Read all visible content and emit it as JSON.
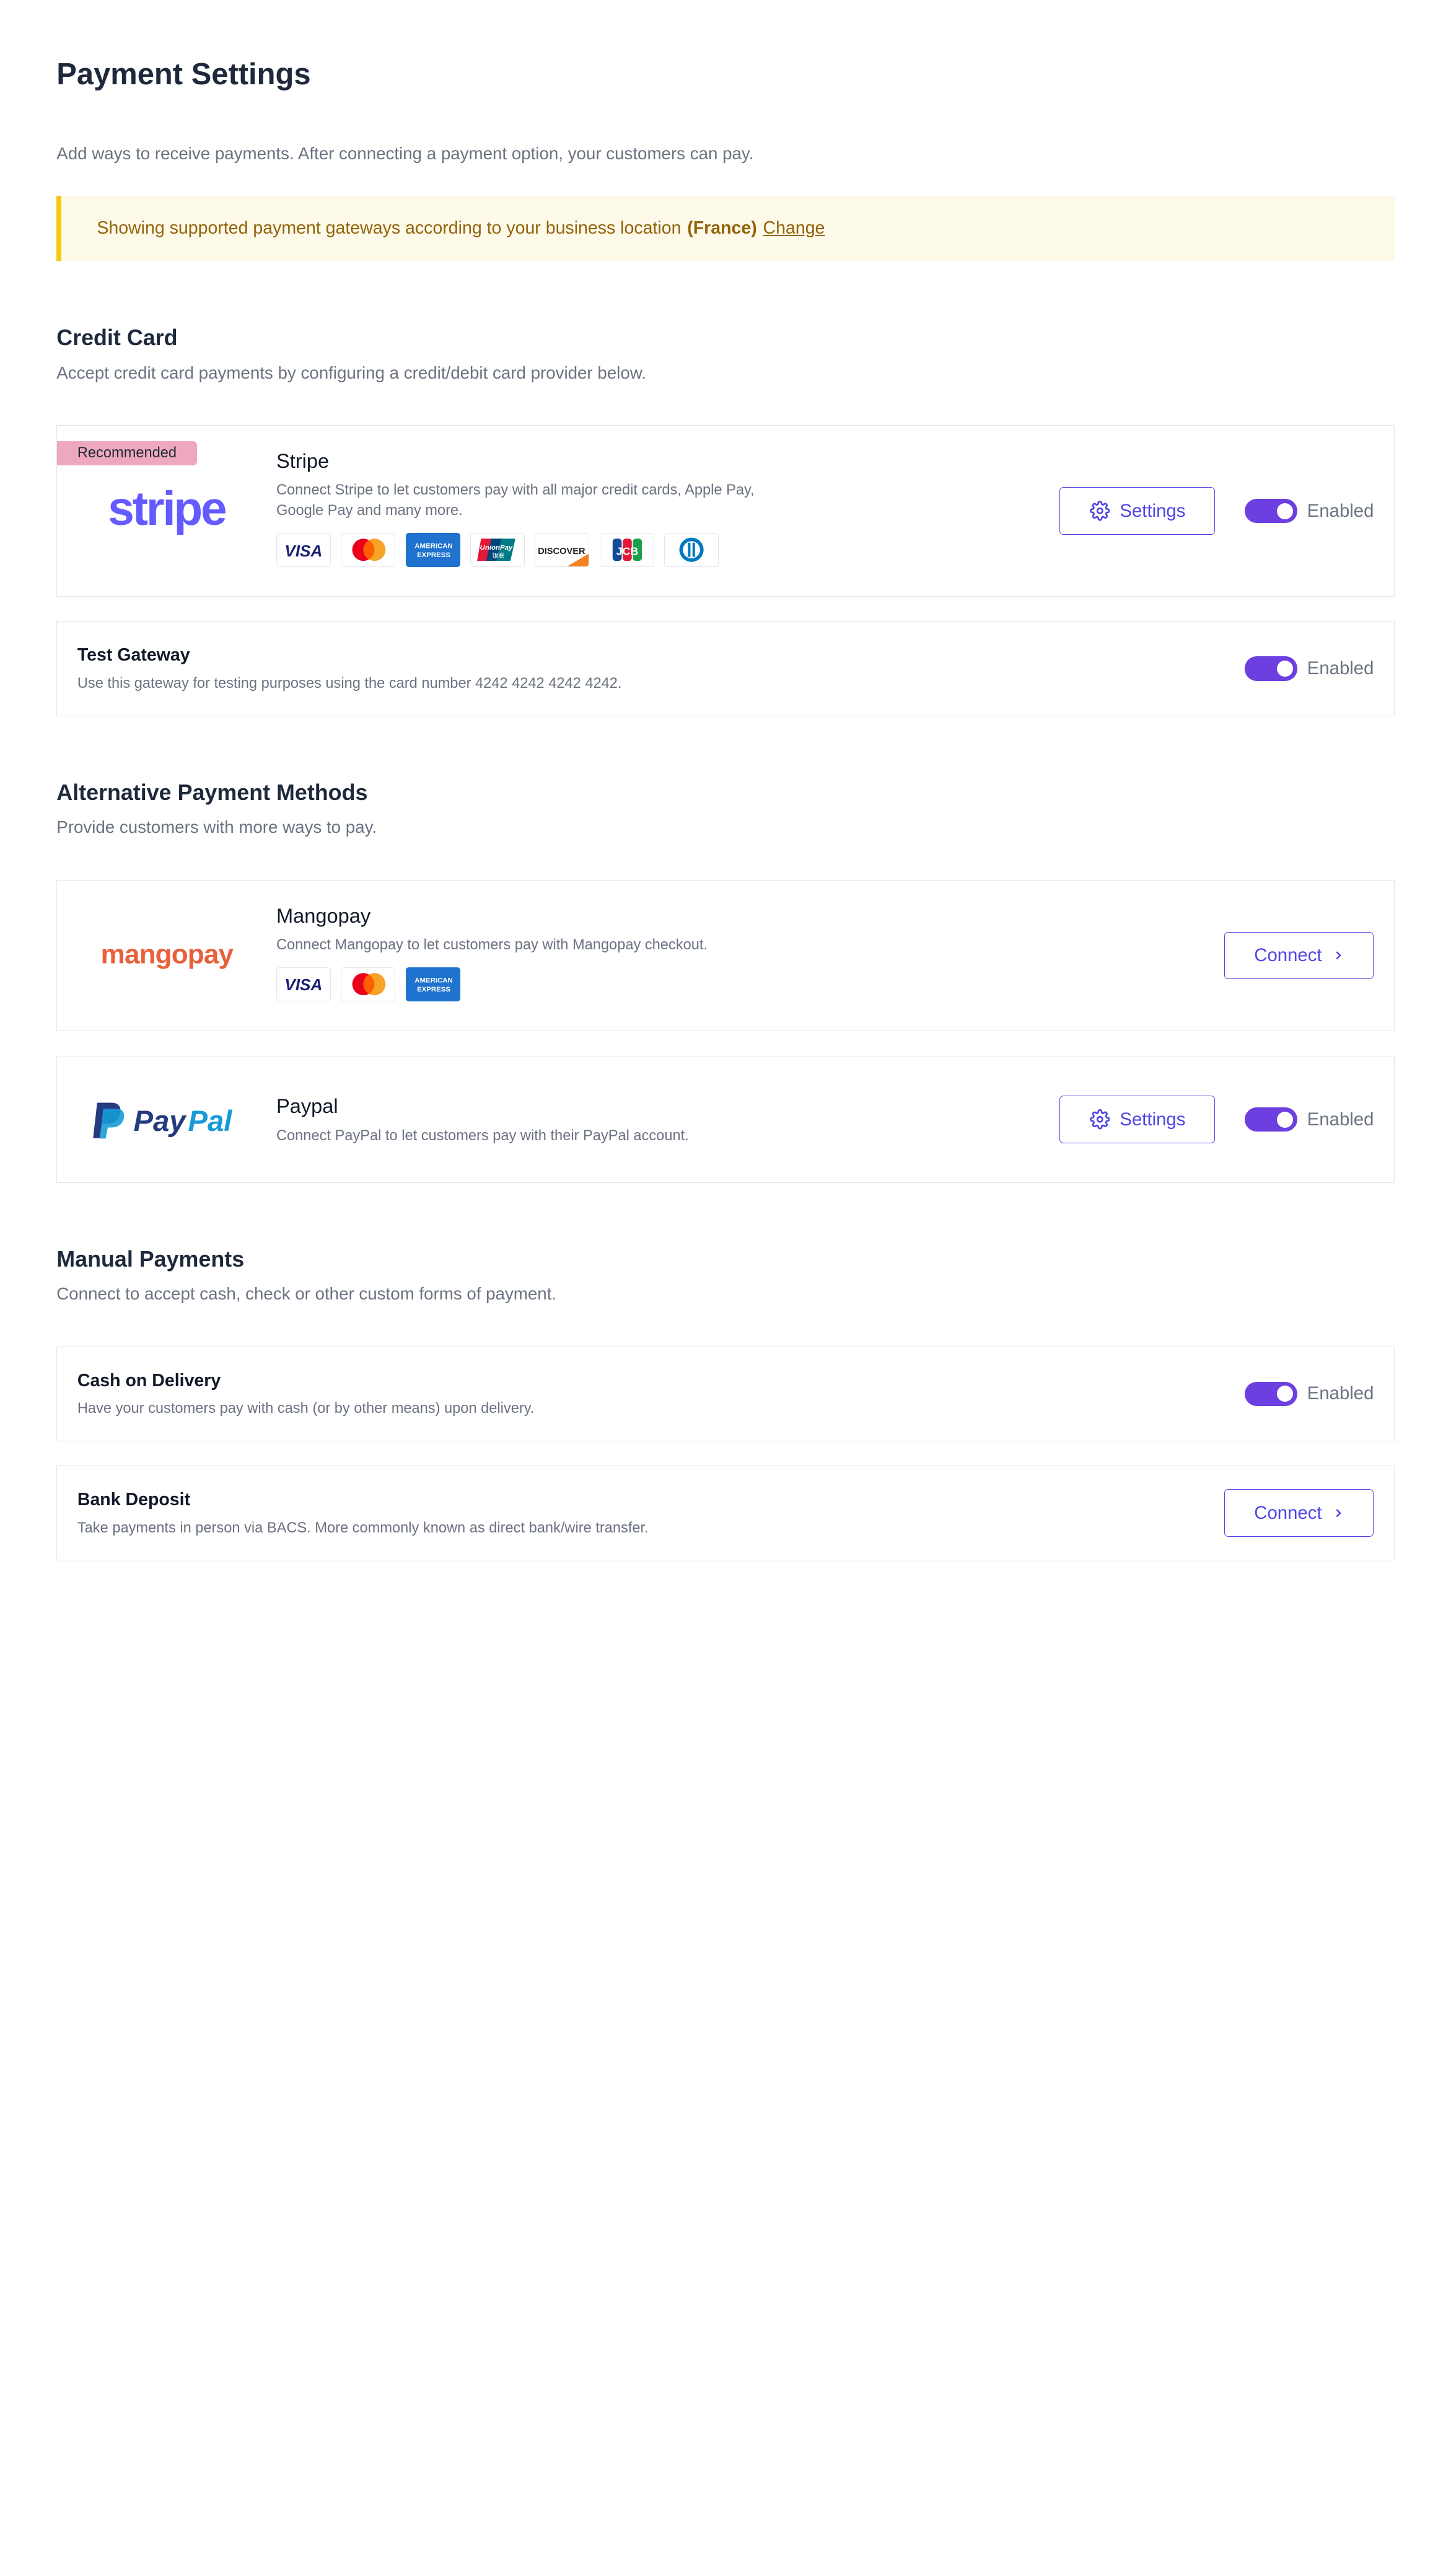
{
  "page": {
    "title": "Payment Settings",
    "subtitle": "Add ways to receive payments. After connecting a payment option, your customers can pay."
  },
  "notice": {
    "text": "Showing supported payment gateways according to your business location",
    "location": "(France)",
    "link": "Change",
    "colors": {
      "background": "#fefaea",
      "border": "#f6c90e",
      "text": "#92630a"
    }
  },
  "credit_card": {
    "title": "Credit Card",
    "subtitle": "Accept credit card payments by configuring a credit/debit card provider below.",
    "stripe": {
      "badge": "Recommended",
      "logo_text": "stripe",
      "name": "Stripe",
      "description": "Connect Stripe to let customers pay with all major credit cards, Apple Pay, Google Pay and many more.",
      "cards": [
        "visa",
        "mastercard",
        "amex",
        "unionpay",
        "discover",
        "jcb",
        "diners"
      ],
      "settings_label": "Settings",
      "status_label": "Enabled"
    },
    "test_gateway": {
      "name": "Test Gateway",
      "description": "Use this gateway for testing purposes using the card number 4242 4242 4242 4242.",
      "status_label": "Enabled"
    }
  },
  "alternative": {
    "title": "Alternative Payment Methods",
    "subtitle": "Provide customers with more ways to pay.",
    "mangopay": {
      "logo_text": "mangopay",
      "name": "Mangopay",
      "description": "Connect Mangopay to let customers pay with Mangopay checkout.",
      "cards": [
        "visa",
        "mastercard",
        "amex"
      ],
      "connect_label": "Connect"
    },
    "paypal": {
      "logo_text_pay": "Pay",
      "logo_text_pal": "Pal",
      "name": "Paypal",
      "description": "Connect PayPal to let customers pay with their PayPal account.",
      "settings_label": "Settings",
      "status_label": "Enabled"
    }
  },
  "manual": {
    "title": "Manual Payments",
    "subtitle": "Connect to accept cash, check or other custom forms of payment.",
    "cod": {
      "name": "Cash on Delivery",
      "description": "Have your customers pay with cash (or by other means) upon delivery.",
      "status_label": "Enabled"
    },
    "bank": {
      "name": "Bank Deposit",
      "description": "Take payments in person via BACS. More commonly known as direct bank/wire transfer.",
      "connect_label": "Connect"
    }
  },
  "card_labels": {
    "visa": "VISA",
    "amex_line1": "AMERICAN",
    "amex_line2": "EXPRESS",
    "unionpay_line1": "UnionPay",
    "unionpay_line2": "银联",
    "discover": "DISCOVER",
    "jcb": "JCB"
  },
  "theme": {
    "accent": "#4f46e5",
    "toggle": "#6d3fe0",
    "badge": "#eda8bf",
    "stripe": "#635bff",
    "mangopay": "#e8603c",
    "paypal_dark": "#253b80",
    "paypal_light": "#179bd7"
  }
}
